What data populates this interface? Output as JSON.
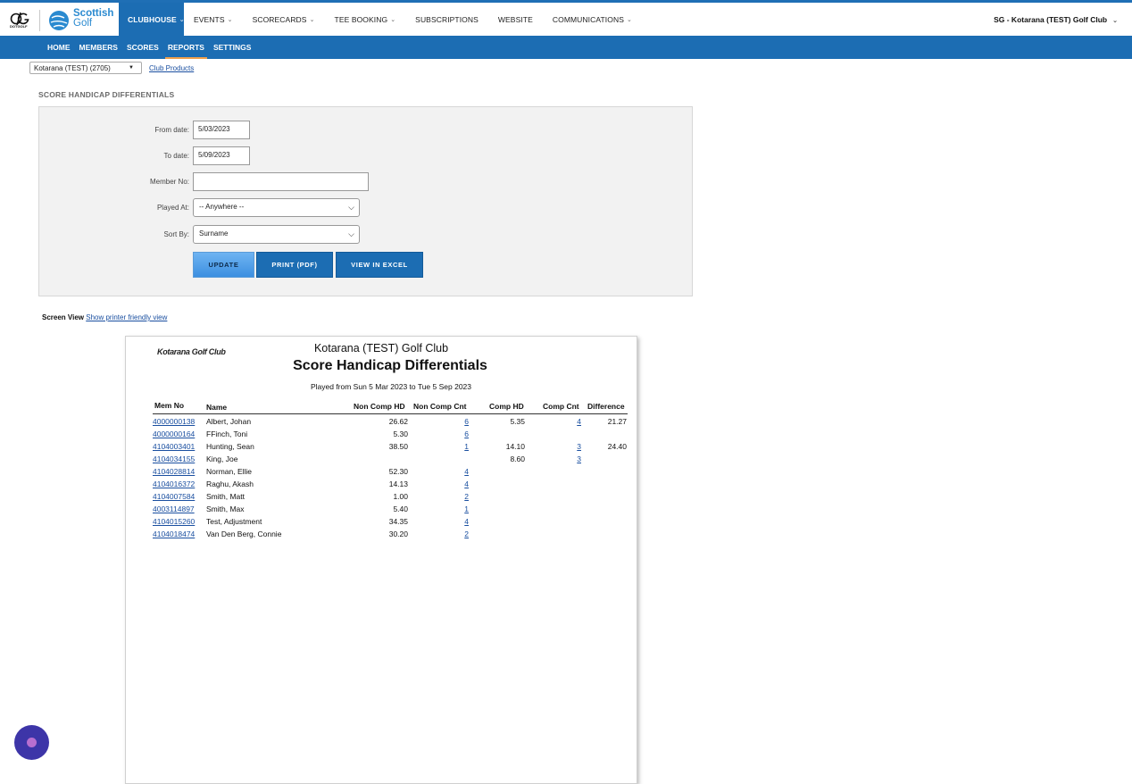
{
  "topnav": {
    "items": [
      {
        "label": "CLUBHOUSE",
        "caret": "⌄"
      },
      {
        "label": "EVENTS",
        "caret": "⌄"
      },
      {
        "label": "SCORECARDS",
        "caret": "⌄"
      },
      {
        "label": "TEE BOOKING",
        "caret": "⌄"
      },
      {
        "label": "SUBSCRIPTIONS"
      },
      {
        "label": "WEBSITE"
      },
      {
        "label": "COMMUNICATIONS",
        "caret": "⌄"
      }
    ],
    "club_name": "SG - Kotarana (TEST) Golf Club",
    "logo_og_text": "DOTGOLF",
    "logo_sg_line1": "Scottish",
    "logo_sg_line2": "Golf"
  },
  "subnav": {
    "items": [
      "HOME",
      "MEMBERS",
      "SCORES",
      "REPORTS",
      "SETTINGS"
    ],
    "active": "REPORTS"
  },
  "club_select": {
    "value": "Kotarana (TEST) (2705)"
  },
  "club_products_link": "Club Products",
  "section_title": "SCORE HANDICAP DIFFERENTIALS",
  "filter": {
    "from_label": "From date:",
    "from_value": "5/03/2023",
    "to_label": "To date:",
    "to_value": "5/09/2023",
    "member_label": "Member No:",
    "member_value": "",
    "played_label": "Played At:",
    "played_value": "-- Anywhere --",
    "sort_label": "Sort By:",
    "sort_value": "Surname",
    "btn_update": "UPDATE",
    "btn_print": "PRINT (PDF)",
    "btn_excel": "VIEW IN EXCEL"
  },
  "view": {
    "label": "Screen View",
    "link": "Show printer friendly view"
  },
  "report": {
    "logo": "Kotarana Golf Club",
    "club": "Kotarana (TEST) Golf Club",
    "title": "Score Handicap Differentials",
    "subtitle": "Played from Sun 5 Mar 2023 to Tue 5 Sep 2023",
    "headers": {
      "mem": "Mem No",
      "name": "Name",
      "nchd": "Non Comp HD",
      "ncc": "Non Comp Cnt",
      "chd": "Comp HD",
      "cc": "Comp Cnt",
      "diff": "Difference"
    },
    "rows": [
      {
        "mem": "4000000138",
        "name": "Albert, Johan",
        "nchd": "26.62",
        "ncc": "6",
        "chd": "5.35",
        "cc": "4",
        "diff": "21.27"
      },
      {
        "mem": "4000000164",
        "name": "FFinch, Toni",
        "nchd": "5.30",
        "ncc": "6",
        "chd": "",
        "cc": "",
        "diff": ""
      },
      {
        "mem": "4104003401",
        "name": "Hunting, Sean",
        "nchd": "38.50",
        "ncc": "1",
        "chd": "14.10",
        "cc": "3",
        "diff": "24.40"
      },
      {
        "mem": "4104034155",
        "name": "King, Joe",
        "nchd": "",
        "ncc": "",
        "chd": "8.60",
        "cc": "3",
        "diff": ""
      },
      {
        "mem": "4104028814",
        "name": "Norman, Ellie",
        "nchd": "52.30",
        "ncc": "4",
        "chd": "",
        "cc": "",
        "diff": ""
      },
      {
        "mem": "4104016372",
        "name": "Raghu, Akash",
        "nchd": "14.13",
        "ncc": "4",
        "chd": "",
        "cc": "",
        "diff": ""
      },
      {
        "mem": "4104007584",
        "name": "Smith, Matt",
        "nchd": "1.00",
        "ncc": "2",
        "chd": "",
        "cc": "",
        "diff": ""
      },
      {
        "mem": "4003114897",
        "name": "Smith, Max",
        "nchd": "5.40",
        "ncc": "1",
        "chd": "",
        "cc": "",
        "diff": ""
      },
      {
        "mem": "4104015260",
        "name": "Test, Adjustment",
        "nchd": "34.35",
        "ncc": "4",
        "chd": "",
        "cc": "",
        "diff": ""
      },
      {
        "mem": "4104018474",
        "name": "Van Den Berg, Connie",
        "nchd": "30.20",
        "ncc": "2",
        "chd": "",
        "cc": "",
        "diff": ""
      }
    ]
  },
  "colors": {
    "nav_blue": "#1c6db3",
    "active_underline": "#f0a04b",
    "link": "#1a4fa0",
    "chat": "#3d35a8"
  }
}
